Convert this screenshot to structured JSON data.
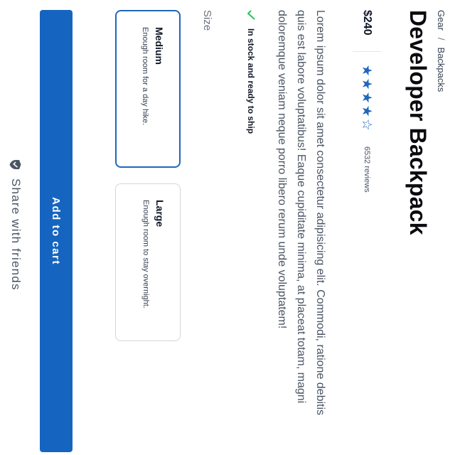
{
  "breadcrumb": {
    "items": [
      "Gear",
      "Backpacks"
    ],
    "separator": "/"
  },
  "product": {
    "title": "Developer Backpack",
    "price": "$240",
    "rating": 4,
    "rating_max": 5,
    "reviews": "6532 reviews",
    "description": "Lorem ipsum dolor sit amet consectetur adipisicing elit. Commodi, ratione debitis quis est labore voluptatibus! Eaque cupiditate minima, at placeat totam, magni doloremque veniam neque porro libero rerum unde voluptatem!",
    "stock_status": "In stock and ready to ship"
  },
  "size": {
    "label": "Size",
    "selected": "Medium",
    "options": [
      {
        "name": "Medium",
        "description": "Enough room for a day hike."
      },
      {
        "name": "Large",
        "description": "Enough room to stay overnight."
      }
    ]
  },
  "actions": {
    "add_to_cart": "Add to cart",
    "share": "Share with friends"
  },
  "icons": {
    "stock": "check-icon",
    "share": "shield-icon",
    "star": "star-icon"
  },
  "colors": {
    "accent": "#1e67bd",
    "button": "#1565c0",
    "check": "#22c55e"
  }
}
